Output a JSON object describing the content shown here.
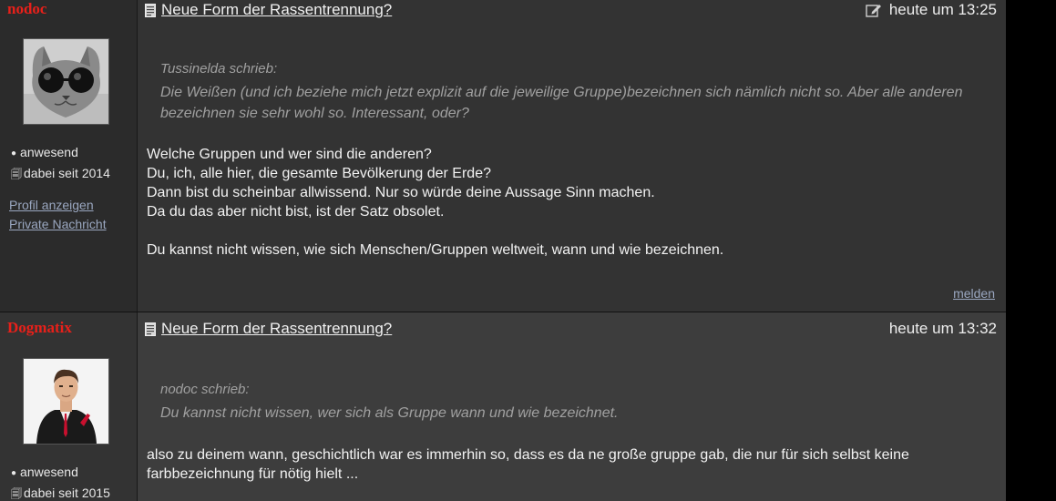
{
  "posts": [
    {
      "author": {
        "name": "nodoc",
        "avatar": "cat-with-sunglasses",
        "status": "anwesend",
        "since": "dabei seit 2014",
        "links": [
          "Profil anzeigen",
          "Private Nachricht"
        ]
      },
      "title": "Neue Form der Rassentrennung?",
      "time": "heute um 13:25",
      "edited_icon": "edit-icon",
      "quote": {
        "author": "Tussinelda schrieb:",
        "text": "Die Weißen (und ich beziehe mich jetzt explizit auf die jeweilige Gruppe)bezeichnen sich nämlich nicht so. Aber alle anderen bezeichnen sie sehr wohl so. Interessant, oder?"
      },
      "lines": [
        "Welche Gruppen und wer sind die anderen?",
        "Du, ich, alle hier, die gesamte Bevölkerung der Erde?",
        "Dann bist du scheinbar allwissend. Nur so würde deine Aussage Sinn machen.",
        "Da du das aber nicht bist, ist der Satz obsolet.",
        "",
        "Du kannst nicht wissen, wie sich Menschen/Gruppen weltweit, wann und wie bezeichnen."
      ],
      "report": "melden"
    },
    {
      "author": {
        "name": "Dogmatix",
        "avatar": "man-in-suit",
        "status": "anwesend",
        "since": "dabei seit 2015"
      },
      "title": "Neue Form der Rassentrennung?",
      "time": "heute um 13:32",
      "quote": {
        "author": "nodoc schrieb:",
        "text": "Du kannst nicht wissen, wer sich als Gruppe wann und wie bezeichnet."
      },
      "lines": [
        "also zu deinem wann, geschichtlich war es immerhin so, dass es da ne große gruppe gab, die nur für sich selbst keine farbbezeichnung für nötig hielt ..."
      ]
    }
  ],
  "colors": {
    "username": "#e8201a",
    "link": "#9aa7c0",
    "quote": "#a0a0a0"
  }
}
